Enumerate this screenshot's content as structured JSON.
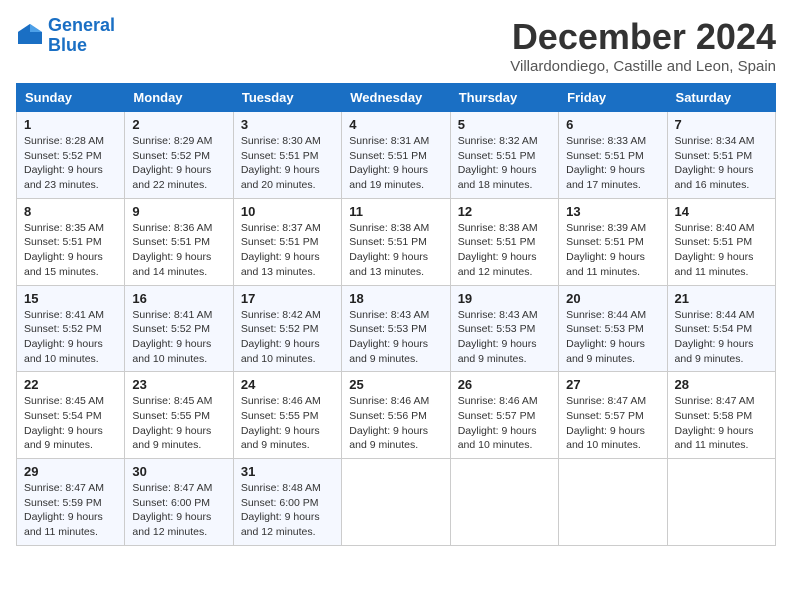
{
  "header": {
    "logo_line1": "General",
    "logo_line2": "Blue",
    "month": "December 2024",
    "location": "Villardondiego, Castille and Leon, Spain"
  },
  "days_of_week": [
    "Sunday",
    "Monday",
    "Tuesday",
    "Wednesday",
    "Thursday",
    "Friday",
    "Saturday"
  ],
  "weeks": [
    [
      {
        "day": "1",
        "info": "Sunrise: 8:28 AM\nSunset: 5:52 PM\nDaylight: 9 hours\nand 23 minutes."
      },
      {
        "day": "2",
        "info": "Sunrise: 8:29 AM\nSunset: 5:52 PM\nDaylight: 9 hours\nand 22 minutes."
      },
      {
        "day": "3",
        "info": "Sunrise: 8:30 AM\nSunset: 5:51 PM\nDaylight: 9 hours\nand 20 minutes."
      },
      {
        "day": "4",
        "info": "Sunrise: 8:31 AM\nSunset: 5:51 PM\nDaylight: 9 hours\nand 19 minutes."
      },
      {
        "day": "5",
        "info": "Sunrise: 8:32 AM\nSunset: 5:51 PM\nDaylight: 9 hours\nand 18 minutes."
      },
      {
        "day": "6",
        "info": "Sunrise: 8:33 AM\nSunset: 5:51 PM\nDaylight: 9 hours\nand 17 minutes."
      },
      {
        "day": "7",
        "info": "Sunrise: 8:34 AM\nSunset: 5:51 PM\nDaylight: 9 hours\nand 16 minutes."
      }
    ],
    [
      {
        "day": "8",
        "info": "Sunrise: 8:35 AM\nSunset: 5:51 PM\nDaylight: 9 hours\nand 15 minutes."
      },
      {
        "day": "9",
        "info": "Sunrise: 8:36 AM\nSunset: 5:51 PM\nDaylight: 9 hours\nand 14 minutes."
      },
      {
        "day": "10",
        "info": "Sunrise: 8:37 AM\nSunset: 5:51 PM\nDaylight: 9 hours\nand 13 minutes."
      },
      {
        "day": "11",
        "info": "Sunrise: 8:38 AM\nSunset: 5:51 PM\nDaylight: 9 hours\nand 13 minutes."
      },
      {
        "day": "12",
        "info": "Sunrise: 8:38 AM\nSunset: 5:51 PM\nDaylight: 9 hours\nand 12 minutes."
      },
      {
        "day": "13",
        "info": "Sunrise: 8:39 AM\nSunset: 5:51 PM\nDaylight: 9 hours\nand 11 minutes."
      },
      {
        "day": "14",
        "info": "Sunrise: 8:40 AM\nSunset: 5:51 PM\nDaylight: 9 hours\nand 11 minutes."
      }
    ],
    [
      {
        "day": "15",
        "info": "Sunrise: 8:41 AM\nSunset: 5:52 PM\nDaylight: 9 hours\nand 10 minutes."
      },
      {
        "day": "16",
        "info": "Sunrise: 8:41 AM\nSunset: 5:52 PM\nDaylight: 9 hours\nand 10 minutes."
      },
      {
        "day": "17",
        "info": "Sunrise: 8:42 AM\nSunset: 5:52 PM\nDaylight: 9 hours\nand 10 minutes."
      },
      {
        "day": "18",
        "info": "Sunrise: 8:43 AM\nSunset: 5:53 PM\nDaylight: 9 hours\nand 9 minutes."
      },
      {
        "day": "19",
        "info": "Sunrise: 8:43 AM\nSunset: 5:53 PM\nDaylight: 9 hours\nand 9 minutes."
      },
      {
        "day": "20",
        "info": "Sunrise: 8:44 AM\nSunset: 5:53 PM\nDaylight: 9 hours\nand 9 minutes."
      },
      {
        "day": "21",
        "info": "Sunrise: 8:44 AM\nSunset: 5:54 PM\nDaylight: 9 hours\nand 9 minutes."
      }
    ],
    [
      {
        "day": "22",
        "info": "Sunrise: 8:45 AM\nSunset: 5:54 PM\nDaylight: 9 hours\nand 9 minutes."
      },
      {
        "day": "23",
        "info": "Sunrise: 8:45 AM\nSunset: 5:55 PM\nDaylight: 9 hours\nand 9 minutes."
      },
      {
        "day": "24",
        "info": "Sunrise: 8:46 AM\nSunset: 5:55 PM\nDaylight: 9 hours\nand 9 minutes."
      },
      {
        "day": "25",
        "info": "Sunrise: 8:46 AM\nSunset: 5:56 PM\nDaylight: 9 hours\nand 9 minutes."
      },
      {
        "day": "26",
        "info": "Sunrise: 8:46 AM\nSunset: 5:57 PM\nDaylight: 9 hours\nand 10 minutes."
      },
      {
        "day": "27",
        "info": "Sunrise: 8:47 AM\nSunset: 5:57 PM\nDaylight: 9 hours\nand 10 minutes."
      },
      {
        "day": "28",
        "info": "Sunrise: 8:47 AM\nSunset: 5:58 PM\nDaylight: 9 hours\nand 11 minutes."
      }
    ],
    [
      {
        "day": "29",
        "info": "Sunrise: 8:47 AM\nSunset: 5:59 PM\nDaylight: 9 hours\nand 11 minutes."
      },
      {
        "day": "30",
        "info": "Sunrise: 8:47 AM\nSunset: 6:00 PM\nDaylight: 9 hours\nand 12 minutes."
      },
      {
        "day": "31",
        "info": "Sunrise: 8:48 AM\nSunset: 6:00 PM\nDaylight: 9 hours\nand 12 minutes."
      },
      {
        "day": "",
        "info": ""
      },
      {
        "day": "",
        "info": ""
      },
      {
        "day": "",
        "info": ""
      },
      {
        "day": "",
        "info": ""
      }
    ]
  ]
}
